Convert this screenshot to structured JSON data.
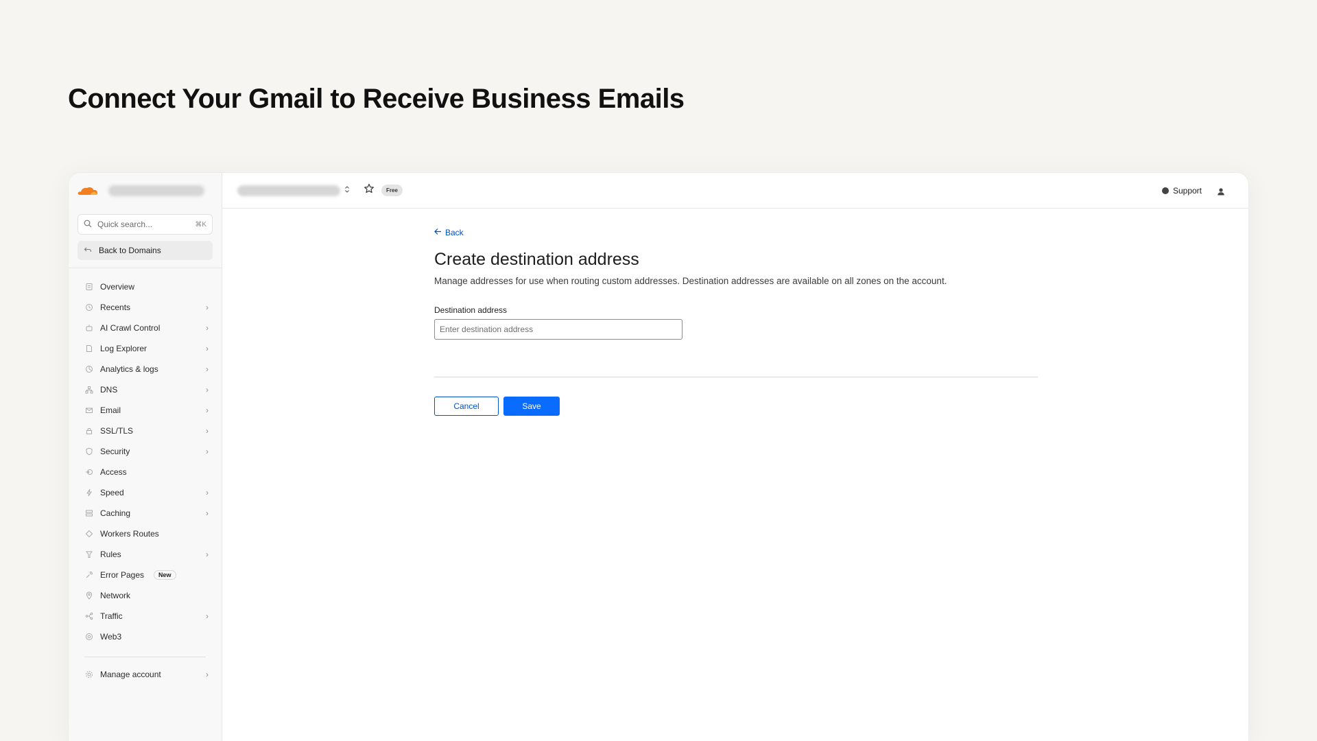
{
  "headline": "Connect Your Gmail to Receive Business Emails",
  "colors": {
    "accent": "#0a6cff",
    "link": "#0051c3",
    "brand_orange": "#f38020"
  },
  "sidebar": {
    "logo_icon": "cloudflare-cloud-icon",
    "quick_search": {
      "placeholder": "Quick search...",
      "shortcut": "⌘K"
    },
    "back_to_domains": "Back to Domains",
    "items": [
      {
        "label": "Overview",
        "icon": "overview-icon",
        "chevron": false
      },
      {
        "label": "Recents",
        "icon": "clock-icon",
        "chevron": true
      },
      {
        "label": "AI Crawl Control",
        "icon": "bot-icon",
        "chevron": true
      },
      {
        "label": "Log Explorer",
        "icon": "log-icon",
        "chevron": true
      },
      {
        "label": "Analytics & logs",
        "icon": "analytics-icon",
        "chevron": true
      },
      {
        "label": "DNS",
        "icon": "dns-icon",
        "chevron": true
      },
      {
        "label": "Email",
        "icon": "email-icon",
        "chevron": true
      },
      {
        "label": "SSL/TLS",
        "icon": "lock-icon",
        "chevron": true
      },
      {
        "label": "Security",
        "icon": "shield-icon",
        "chevron": true
      },
      {
        "label": "Access",
        "icon": "access-icon",
        "chevron": false
      },
      {
        "label": "Speed",
        "icon": "bolt-icon",
        "chevron": true
      },
      {
        "label": "Caching",
        "icon": "cache-icon",
        "chevron": true
      },
      {
        "label": "Workers Routes",
        "icon": "workers-icon",
        "chevron": false
      },
      {
        "label": "Rules",
        "icon": "rules-icon",
        "chevron": true
      },
      {
        "label": "Error Pages",
        "icon": "wrench-icon",
        "chevron": false,
        "badge": "New"
      },
      {
        "label": "Network",
        "icon": "pin-icon",
        "chevron": false
      },
      {
        "label": "Traffic",
        "icon": "traffic-icon",
        "chevron": true
      },
      {
        "label": "Web3",
        "icon": "web3-icon",
        "chevron": false
      }
    ],
    "manage_account": "Manage account"
  },
  "topbar": {
    "plan_badge": "Free",
    "support_label": "Support"
  },
  "main": {
    "back_label": "Back",
    "title": "Create destination address",
    "description": "Manage addresses for use when routing custom addresses. Destination addresses are available on all zones on the account.",
    "field_label": "Destination address",
    "field_placeholder": "Enter destination address",
    "field_value": "",
    "cancel_label": "Cancel",
    "save_label": "Save"
  }
}
